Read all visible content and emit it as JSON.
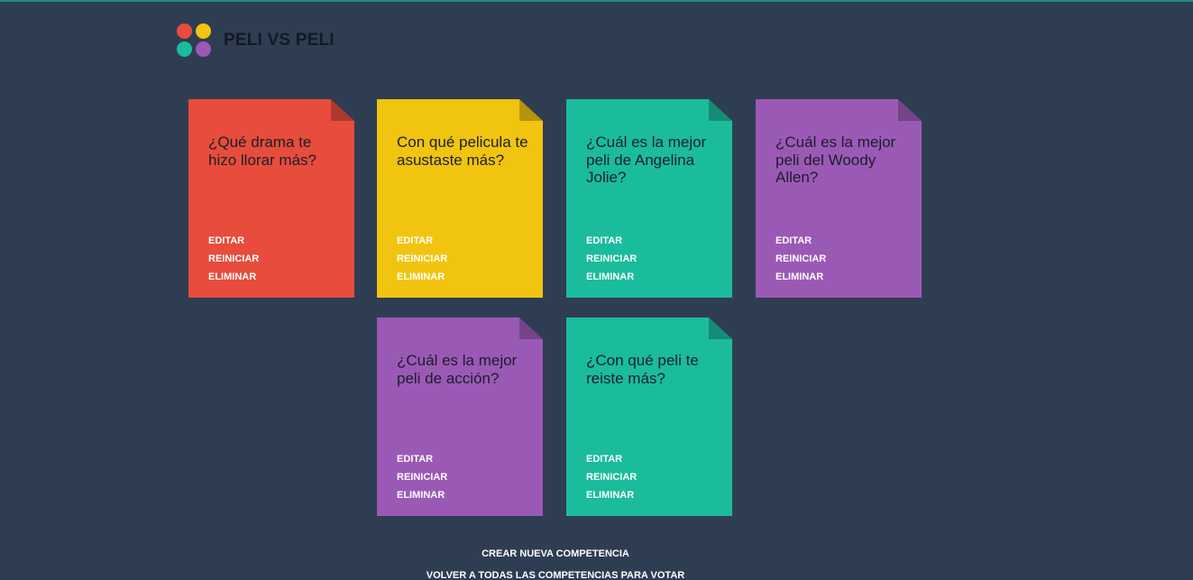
{
  "header": {
    "title": "PELI VS PELI",
    "logo_colors": [
      "#e74c3c",
      "#f1c40f",
      "#1abc9c",
      "#9b59b6"
    ]
  },
  "cards": [
    {
      "question": "¿Qué drama te hizo llorar más?",
      "color": "#e74c3c",
      "actions": [
        "EDITAR",
        "REINICIAR",
        "ELIMINAR"
      ]
    },
    {
      "question": "Con qué pelicula te asustaste más?",
      "color": "#f1c40f",
      "actions": [
        "EDITAR",
        "REINICIAR",
        "ELIMINAR"
      ]
    },
    {
      "question": "¿Cuál es la mejor peli de Angelina Jolie?",
      "color": "#1abc9c",
      "actions": [
        "EDITAR",
        "REINICIAR",
        "ELIMINAR"
      ]
    },
    {
      "question": "¿Cuál es la mejor peli del Woody Allen?",
      "color": "#9b59b6",
      "actions": [
        "EDITAR",
        "REINICIAR",
        "ELIMINAR"
      ]
    },
    {
      "question": "¿Cuál es la mejor peli de acción?",
      "color": "#9b59b6",
      "actions": [
        "EDITAR",
        "REINICIAR",
        "ELIMINAR"
      ]
    },
    {
      "question": "¿Con qué peli te reiste más?",
      "color": "#1abc9c",
      "actions": [
        "EDITAR",
        "REINICIAR",
        "ELIMINAR"
      ]
    }
  ],
  "footer": {
    "create_label": "CREAR NUEVA COMPETENCIA",
    "back_label": "VOLVER A TODAS LAS COMPETENCIAS PARA VOTAR"
  }
}
